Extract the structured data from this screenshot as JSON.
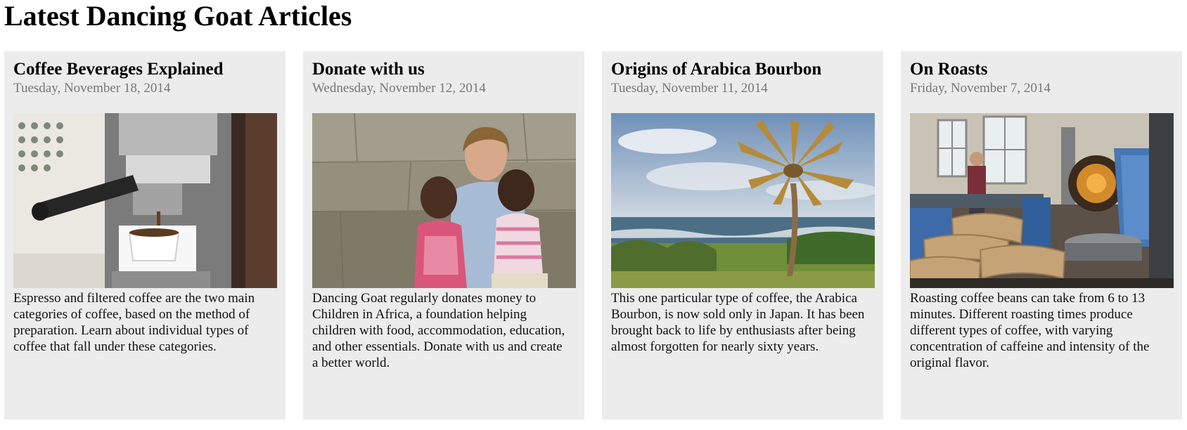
{
  "page": {
    "title": "Latest Dancing Goat Articles"
  },
  "articles": [
    {
      "title": "Coffee Beverages Explained",
      "date": "Tuesday, November 18, 2014",
      "image_subject": "espresso machine pouring into a white cup",
      "summary": "Espresso and filtered coffee are the two main categories of coffee, based on the method of preparation. Learn about individual types of coffee that fall under these categories."
    },
    {
      "title": "Donate with us",
      "date": "Wednesday, November 12, 2014",
      "image_subject": "woman smiling with two children in front of a stone wall",
      "summary": "Dancing Goat regularly donates money to Children in Africa, a foundation helping children with food, accommodation, education, and other essentials. Donate with us and create a better world."
    },
    {
      "title": "Origins of Arabica Bourbon",
      "date": "Tuesday, November 11, 2014",
      "image_subject": "palm tree on a grassy coast by the ocean",
      "summary": "This one particular type of coffee, the Arabica Bourbon, is now sold only in Japan. It has been brought back to life by enthusiasts after being almost forgotten for nearly sixty years."
    },
    {
      "title": "On Roasts",
      "date": "Friday, November 7, 2014",
      "image_subject": "coffee roasting machine with sacks of beans in a workshop",
      "summary": "Roasting coffee beans can take from 6 to 13 minutes. Different roasting times produce different types of coffee, with varying concentration of caffeine and intensity of the original flavor."
    }
  ]
}
